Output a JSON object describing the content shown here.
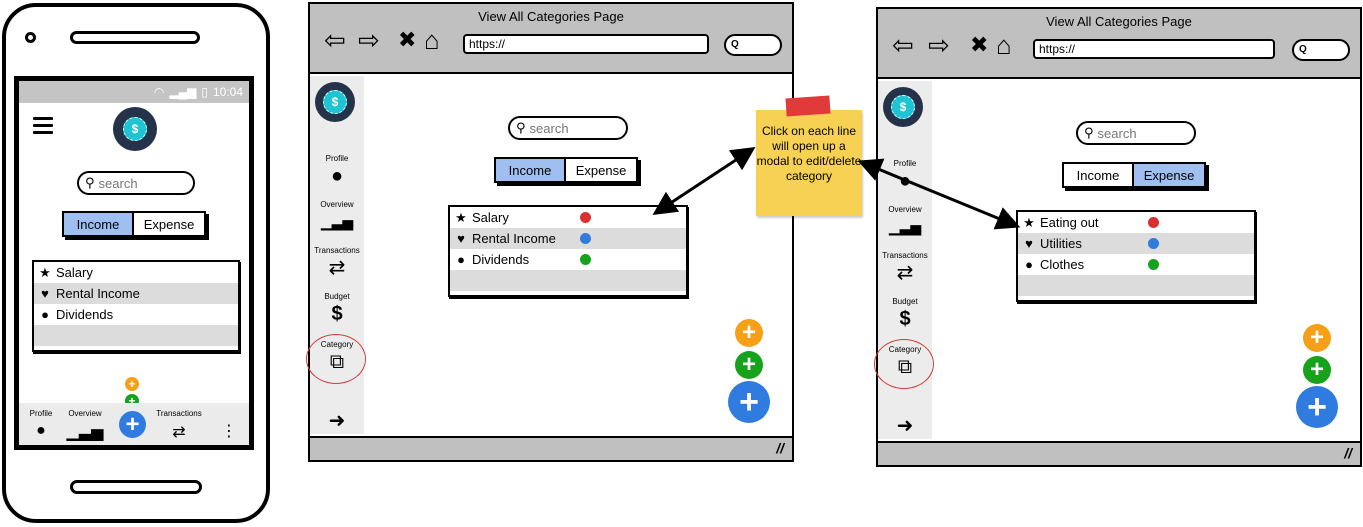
{
  "phone": {
    "status_bar": {
      "time": "10:04",
      "icons": [
        "wifi-icon",
        "signal-icon",
        "battery-icon"
      ]
    },
    "search": {
      "placeholder": "search"
    },
    "toggle": {
      "options": [
        "Income",
        "Expense"
      ],
      "active": "Income"
    },
    "categories": [
      {
        "icon": "star-icon",
        "glyph": "★",
        "label": "Salary"
      },
      {
        "icon": "heart-icon",
        "glyph": "♥",
        "label": "Rental Income"
      },
      {
        "icon": "circle-icon",
        "glyph": "●",
        "label": "Dividends"
      }
    ],
    "bottom_nav": [
      {
        "label": "Profile",
        "icon": "user-icon",
        "glyph": "👤"
      },
      {
        "label": "Overview",
        "icon": "bar-chart-icon",
        "glyph": "📊"
      },
      {
        "label": "Transactions",
        "icon": "transfer-icon",
        "glyph": "⇄"
      },
      {
        "label": "",
        "icon": "more-vertical-icon",
        "glyph": "⋮"
      }
    ],
    "fab_glyph": "+"
  },
  "browsers": [
    {
      "title": "View All Categories Page",
      "url": "https://",
      "search": {
        "placeholder": "search"
      },
      "toggle": {
        "options": [
          "Income",
          "Expense"
        ],
        "active": "Income"
      },
      "categories": [
        {
          "icon": "star-icon",
          "glyph": "★",
          "label": "Salary",
          "color": "#d83030"
        },
        {
          "icon": "heart-icon",
          "glyph": "♥",
          "label": "Rental Income",
          "color": "#2f7be0"
        },
        {
          "icon": "circle-icon",
          "glyph": "●",
          "label": "Dividends",
          "color": "#16a21a"
        }
      ]
    },
    {
      "title": "View All Categories Page",
      "url": "https://",
      "search": {
        "placeholder": "search"
      },
      "toggle": {
        "options": [
          "Income",
          "Expense"
        ],
        "active": "Expense"
      },
      "categories": [
        {
          "icon": "star-icon",
          "glyph": "★",
          "label": "Eating out",
          "color": "#d83030"
        },
        {
          "icon": "heart-icon",
          "glyph": "♥",
          "label": "Utilities",
          "color": "#2f7be0"
        },
        {
          "icon": "circle-icon",
          "glyph": "●",
          "label": "Clothes",
          "color": "#16a21a"
        }
      ]
    }
  ],
  "sidebar": [
    {
      "label": "Profile",
      "icon": "user-icon",
      "glyph": "👤"
    },
    {
      "label": "Overview",
      "icon": "bar-chart-icon",
      "glyph": "📊"
    },
    {
      "label": "Transactions",
      "icon": "transfer-icon",
      "glyph": "⇄"
    },
    {
      "label": "Budget",
      "icon": "dollar-icon",
      "glyph": "$"
    },
    {
      "label": "Category",
      "icon": "cubes-icon",
      "glyph": "⧉",
      "highlighted": true
    },
    {
      "label": "",
      "icon": "logout-icon",
      "glyph": "➜"
    }
  ],
  "browser_nav": {
    "back": "⇦",
    "forward": "⇨",
    "stop": "✖",
    "home": "⌂",
    "search_glyph": "Q",
    "grip": "//"
  },
  "fabs": {
    "glyph": "+",
    "colors": {
      "orange": "#f5a017",
      "green": "#16a21a",
      "blue": "#2f7be0"
    }
  },
  "sticky_note": {
    "text": "Click on each line will open up a modal to edit/delete category"
  },
  "colors": {
    "toggle_active": "#9ebff0",
    "chrome_gray": "#c0c0c0",
    "highlight_circle": "#d23b3b",
    "sticky": "#f7d154"
  }
}
